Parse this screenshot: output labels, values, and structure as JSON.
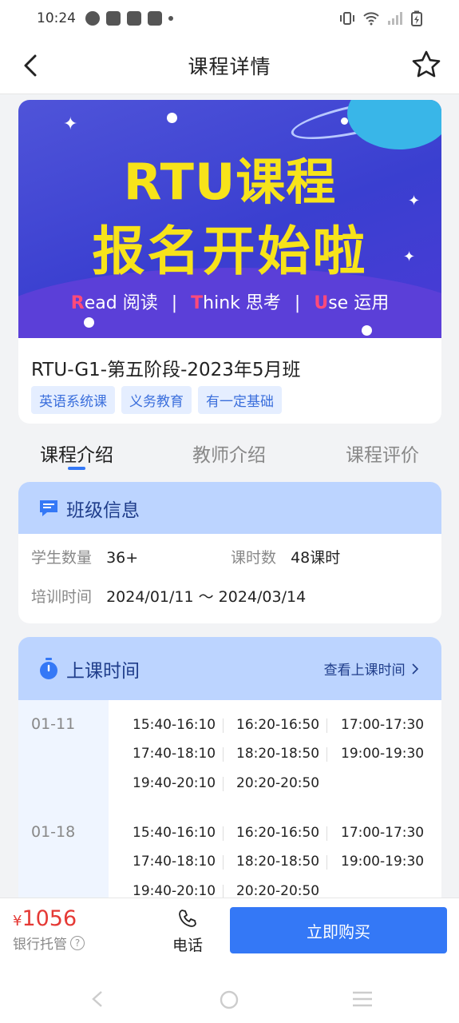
{
  "status_bar": {
    "time": "10:24"
  },
  "nav": {
    "title": "课程详情"
  },
  "banner": {
    "line1": "RTU课程",
    "line2": "报名开始啦",
    "tagline": [
      {
        "hl": "R",
        "rest": "ead 阅读"
      },
      {
        "hl": "T",
        "rest": "hink 思考"
      },
      {
        "hl": "U",
        "rest": "se 运用"
      }
    ],
    "separator": "|"
  },
  "course": {
    "title": "RTU-G1-第五阶段-2023年5月班",
    "tags": [
      "英语系统课",
      "义务教育",
      "有一定基础"
    ]
  },
  "tabs": [
    "课程介绍",
    "教师介绍",
    "课程评价"
  ],
  "class_info": {
    "title": "班级信息",
    "student_count_label": "学生数量",
    "student_count": "36+",
    "hours_label": "课时数",
    "hours": "48课时",
    "period_label": "培训时间",
    "period": "2024/01/11 ～ 2024/03/14"
  },
  "schedule": {
    "title": "上课时间",
    "view_link": "查看上课时间",
    "days": [
      {
        "date": "01-11",
        "slots": [
          "15:40-16:10",
          "16:20-16:50",
          "17:00-17:30",
          "17:40-18:10",
          "18:20-18:50",
          "19:00-19:30",
          "19:40-20:10",
          "20:20-20:50"
        ]
      },
      {
        "date": "01-18",
        "slots": [
          "15:40-16:10",
          "16:20-16:50",
          "17:00-17:30",
          "17:40-18:10",
          "18:20-18:50",
          "19:00-19:30",
          "19:40-20:10",
          "20:20-20:50"
        ]
      }
    ]
  },
  "bottom": {
    "currency": "¥",
    "price": "1056",
    "escrow": "银行托管",
    "escrow_help": "?",
    "phone_label": "电话",
    "buy_label": "立即购买"
  },
  "colors": {
    "accent": "#3478f6",
    "price": "#e53935",
    "section_header": "#bcd4ff",
    "banner_text": "#f7e31a"
  }
}
